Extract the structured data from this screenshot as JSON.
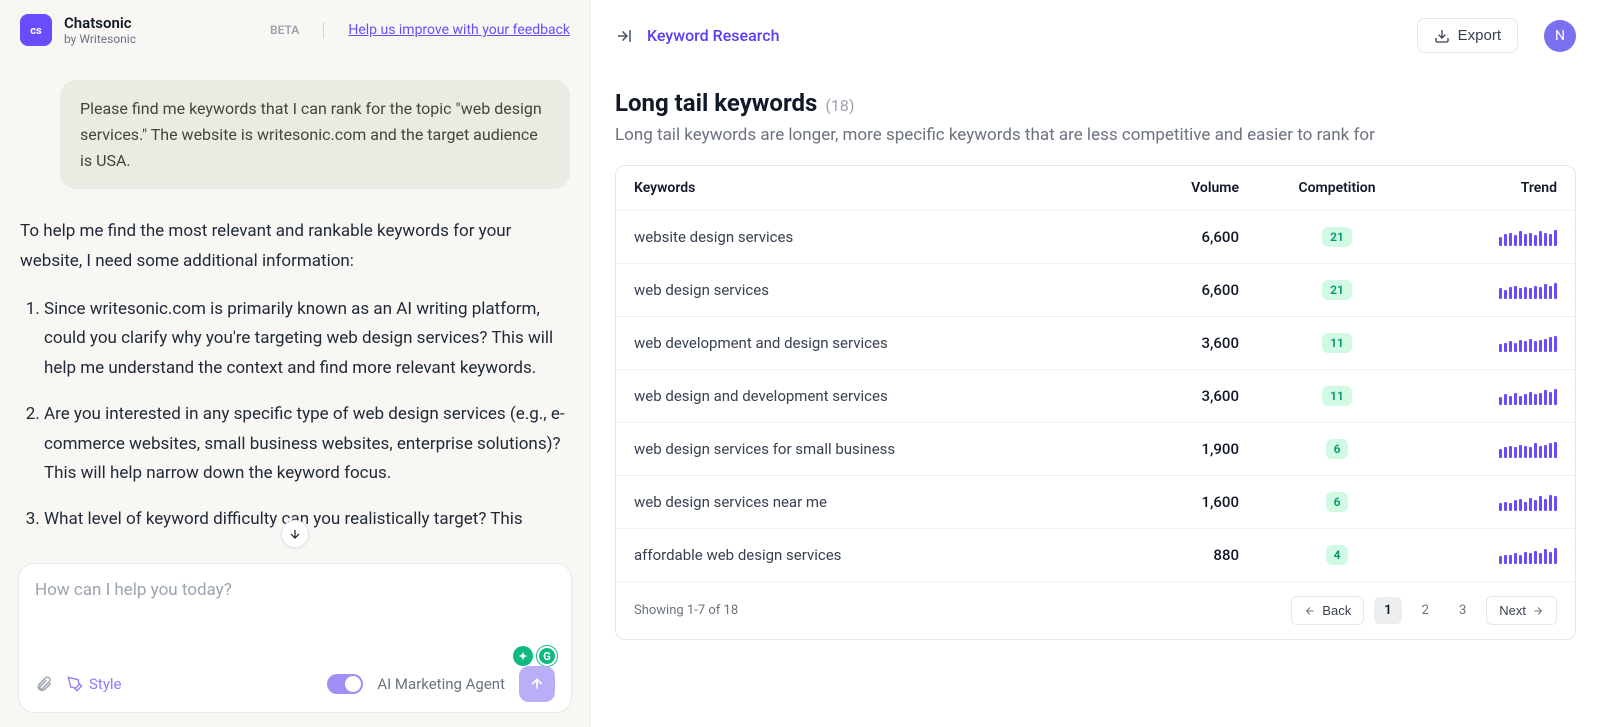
{
  "brand": {
    "badge": "cs",
    "title": "Chatsonic",
    "subtitle": "by Writesonic"
  },
  "beta": "BETA",
  "feedback": "Help us improve with your feedback",
  "chat": {
    "user": "Please find me keywords that I can rank for the topic \"web design services.\" The website is writesonic.com and the target audience is USA.",
    "assistant_intro": "To help me find the most relevant and rankable keywords for your website, I need some additional information:",
    "assistant_items": [
      "Since writesonic.com is primarily known as an AI writing platform, could you clarify why you're targeting web design services? This will help me understand the context and find more relevant keywords.",
      "Are you interested in any specific type of web design services (e.g., e-commerce websites, small business websites, enterprise solutions)? This will help narrow down the keyword focus.",
      "What level of keyword difficulty can you realistically target? This"
    ]
  },
  "composer": {
    "placeholder": "How can I help you today?",
    "style": "Style",
    "agent": "AI Marketing Agent"
  },
  "right": {
    "breadcrumb": "Keyword Research",
    "export": "Export",
    "avatar": "N",
    "title": "Long tail keywords",
    "count": "(18)",
    "desc": "Long tail keywords are longer, more specific keywords that are less competitive and easier to rank for",
    "headers": {
      "keywords": "Keywords",
      "volume": "Volume",
      "competition": "Competition",
      "trend": "Trend"
    },
    "rows": [
      {
        "keyword": "website design services",
        "volume": "6,600",
        "competition": "21",
        "trend": [
          4,
          6,
          7,
          5,
          8,
          6,
          7,
          5,
          8,
          7,
          6,
          9
        ]
      },
      {
        "keyword": "web design services",
        "volume": "6,600",
        "competition": "21",
        "trend": [
          5,
          4,
          6,
          7,
          5,
          6,
          5,
          7,
          6,
          8,
          7,
          9
        ]
      },
      {
        "keyword": "web development and design services",
        "volume": "3,600",
        "competition": "11",
        "trend": [
          3,
          4,
          5,
          4,
          6,
          5,
          7,
          5,
          6,
          7,
          8,
          9
        ]
      },
      {
        "keyword": "web design and development services",
        "volume": "3,600",
        "competition": "11",
        "trend": [
          3,
          5,
          4,
          6,
          4,
          5,
          7,
          5,
          6,
          8,
          7,
          9
        ]
      },
      {
        "keyword": "web design services for small business",
        "volume": "1,900",
        "competition": "6",
        "trend": [
          4,
          5,
          6,
          5,
          7,
          6,
          5,
          8,
          6,
          7,
          8,
          9
        ]
      },
      {
        "keyword": "web design services near me",
        "volume": "1,600",
        "competition": "6",
        "trend": [
          3,
          4,
          3,
          5,
          6,
          4,
          7,
          5,
          8,
          6,
          9,
          8
        ]
      },
      {
        "keyword": "affordable web design services",
        "volume": "880",
        "competition": "4",
        "trend": [
          3,
          4,
          4,
          5,
          4,
          6,
          5,
          7,
          5,
          8,
          6,
          9
        ]
      }
    ],
    "pagination": {
      "status": "Showing 1-7 of 18",
      "back": "Back",
      "pages": [
        "1",
        "2",
        "3"
      ],
      "next": "Next"
    }
  }
}
